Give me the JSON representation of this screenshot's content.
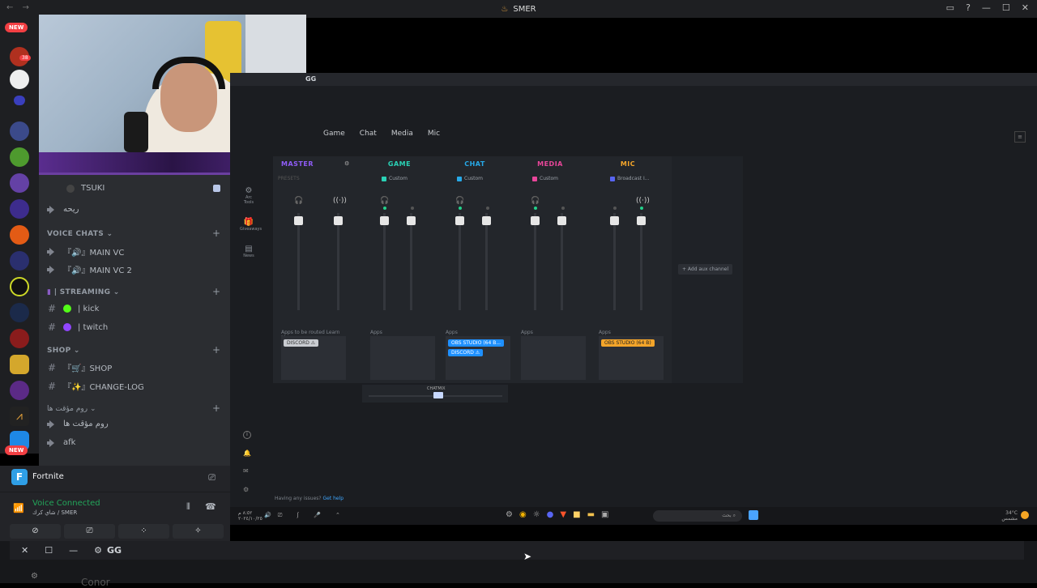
{
  "window": {
    "title": "SMER"
  },
  "rail": {
    "badge_top": "NEW",
    "badge_bottom": "NEW",
    "mention_count": "38",
    "ping_count": "1"
  },
  "channels": {
    "tsuki": "TSUKI",
    "arabic_voice": "ريحه",
    "cat_voice": "VOICE CHATS",
    "main_vc": "『🔊』MAIN VC",
    "main_vc2": "『🔊』MAIN VC 2",
    "cat_streaming": "| STREAMING",
    "kick": "| kick",
    "twitch": "| twitch",
    "cat_shop": "SHOP",
    "shop": "『🛒』SHOP",
    "changelog": "『✨』CHANGE-LOG",
    "cat_temp": "روم مؤقت ها",
    "temp_room": "روم مؤقت ها",
    "afk": "afk"
  },
  "activity": {
    "game": "Fortnite"
  },
  "voice": {
    "status": "Voice Connected",
    "location": "شاي كرك / SMER"
  },
  "gg": {
    "title": "GG",
    "tabs": [
      "Game",
      "Chat",
      "Media",
      "Mic"
    ],
    "nav": {
      "tools": "Arc Tools",
      "giveaways": "Giveaways",
      "news": "News"
    },
    "columns": [
      {
        "name": "MASTER",
        "sub": "PRESETS",
        "color": "#8f5cf7",
        "apps_label": "Apps to be routed Learn More",
        "apps": [
          {
            "text": "DISCORD ⚠",
            "bg": "#c9ccd1",
            "fg": "#333"
          }
        ]
      },
      {
        "name": "GAME",
        "sub": "Custom",
        "color": "#2ad1b5",
        "apps_label": "Apps",
        "apps": []
      },
      {
        "name": "CHAT",
        "sub": "Custom",
        "color": "#27a9e8",
        "apps_label": "Apps",
        "apps": [
          {
            "text": "OBS STUDIO (64 B...",
            "bg": "#1e90ff",
            "fg": "#fff"
          },
          {
            "text": "DISCORD ⚠",
            "bg": "#1e90ff",
            "fg": "#fff"
          }
        ]
      },
      {
        "name": "MEDIA",
        "sub": "Custom",
        "color": "#e9469a",
        "apps_label": "Apps",
        "apps": []
      },
      {
        "name": "MIC",
        "sub": "Broadcast I...",
        "color": "#f4a52a",
        "apps_label": "Apps",
        "apps": [
          {
            "text": "OBS STUDIO (64 B)",
            "bg": "#f4a52a",
            "fg": "#222"
          }
        ]
      }
    ],
    "add_aux": "+ Add aux channel",
    "chatmix": "CHATMIX",
    "help_text": "Having any issues?",
    "help_link": "Get help"
  },
  "taskbar": {
    "time": "٨:٥٢ م",
    "date": "٢٠٢٤/١٠/٢٥",
    "search_placeholder": "بحث",
    "temp": "34°C",
    "weather": "مشمس"
  },
  "bottom": {
    "title": "GG",
    "peek": "Conor"
  },
  "colors": {
    "discord_bg": "#2b2d31",
    "rail_bg": "#1e1f22",
    "gg_bg": "#1b1d21",
    "accent_green": "#23a55a"
  }
}
